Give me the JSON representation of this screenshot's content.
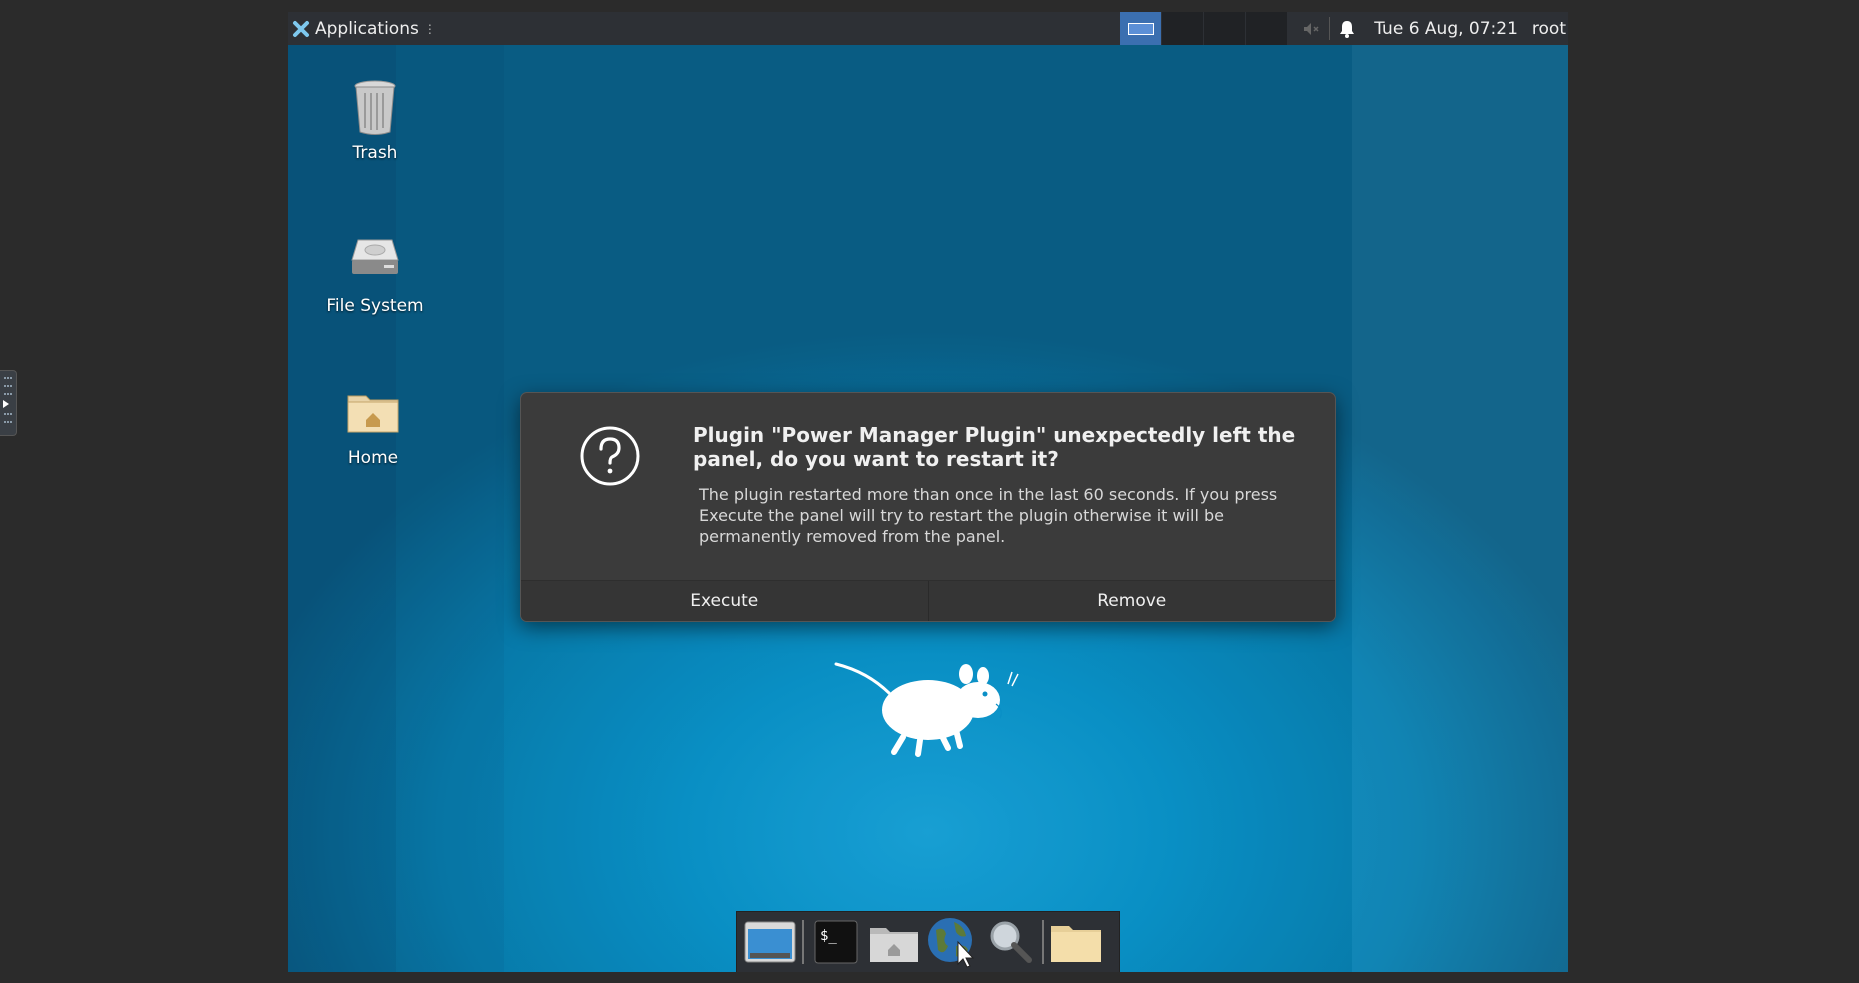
{
  "top_panel": {
    "applications_label": "Applications",
    "clock": "Tue  6 Aug, 07:21",
    "user": "root"
  },
  "desktop": {
    "icons": [
      {
        "label": "Trash"
      },
      {
        "label": "File System"
      },
      {
        "label": "Home"
      }
    ]
  },
  "dialog": {
    "title": "Plugin \"Power Manager Plugin\" unexpectedly left the panel, do you want to restart it?",
    "body": "The plugin restarted more than once in the last 60 seconds. If you press Execute the panel will try to restart the plugin otherwise it will be permanently removed from the panel.",
    "execute_label": "Execute",
    "remove_label": "Remove"
  },
  "colors": {
    "panel_bg": "#2d3035",
    "desktop_blue": "#0a95cc",
    "dialog_bg": "#3b3b3b",
    "workspace_active": "#3b6fb0"
  }
}
